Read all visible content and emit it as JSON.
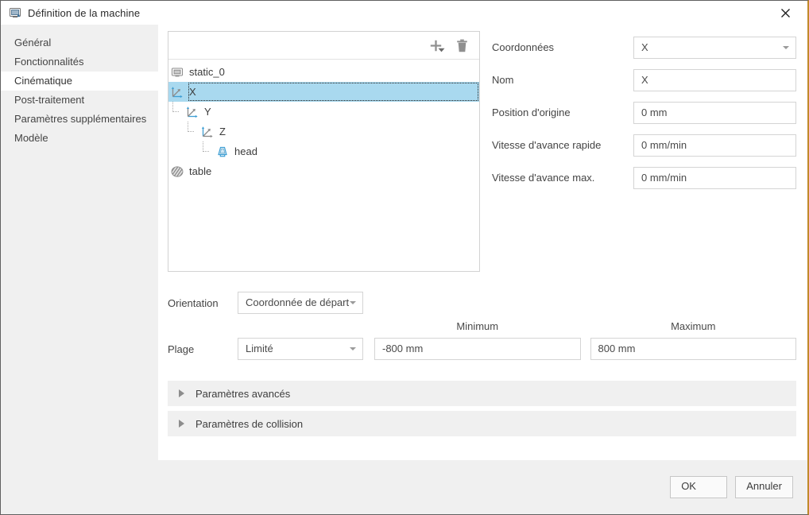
{
  "window": {
    "title": "Définition de la machine",
    "title_icon": "machine-monitor-icon",
    "close_icon": "close-icon",
    "accent_border_color": "#c08a2a"
  },
  "sidebar": {
    "items": [
      {
        "label": "Général",
        "active": false
      },
      {
        "label": "Fonctionnalités",
        "active": false
      },
      {
        "label": "Cinématique",
        "active": true
      },
      {
        "label": "Post-traitement",
        "active": false
      },
      {
        "label": "Paramètres supplémentaires",
        "active": false
      },
      {
        "label": "Modèle",
        "active": false
      }
    ]
  },
  "tree": {
    "toolbar": {
      "add_icon": "plus-icon",
      "add_caret_icon": "chevron-down-icon",
      "delete_icon": "trash-icon"
    },
    "nodes": [
      {
        "label": "static_0",
        "icon": "static-base-icon",
        "depth": 0,
        "selected": false
      },
      {
        "label": "X",
        "icon": "axis-icon",
        "depth": 0,
        "selected": true
      },
      {
        "label": "Y",
        "icon": "axis-icon",
        "depth": 1,
        "selected": false
      },
      {
        "label": "Z",
        "icon": "axis-icon",
        "depth": 2,
        "selected": false
      },
      {
        "label": "head",
        "icon": "spindle-head-icon",
        "depth": 3,
        "selected": false
      },
      {
        "label": "table",
        "icon": "table-disc-icon",
        "depth": 0,
        "selected": false
      }
    ],
    "selection_color": "#a9d9ef"
  },
  "form": {
    "fields": [
      {
        "label": "Coordonnées",
        "value": "X",
        "type": "select"
      },
      {
        "label": "Nom",
        "value": "X",
        "type": "text"
      },
      {
        "label": "Position d'origine",
        "value": "0 mm",
        "type": "text"
      },
      {
        "label": "Vitesse d'avance rapide",
        "value": "0 mm/min",
        "type": "text"
      },
      {
        "label": "Vitesse d'avance max.",
        "value": "0 mm/min",
        "type": "text"
      }
    ]
  },
  "orientation": {
    "label": "Orientation",
    "value": "Coordonnée de départ"
  },
  "range": {
    "label": "Plage",
    "mode": "Limité",
    "minimum_header": "Minimum",
    "maximum_header": "Maximum",
    "minimum": "-800 mm",
    "maximum": "800 mm"
  },
  "accordions": [
    {
      "label": "Paramètres avancés",
      "expanded": false
    },
    {
      "label": "Paramètres de collision",
      "expanded": false
    }
  ],
  "footer": {
    "ok": "OK",
    "cancel": "Annuler"
  }
}
